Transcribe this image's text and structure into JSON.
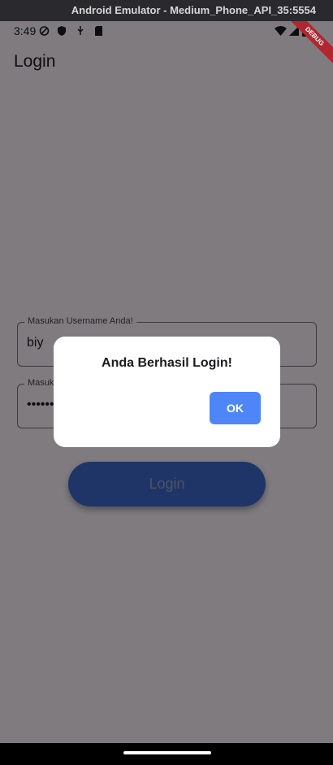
{
  "window": {
    "title": "Android Emulator - Medium_Phone_API_35:5554"
  },
  "status_bar": {
    "time": "3:49"
  },
  "debug_banner": "DEBUG",
  "app_bar": {
    "title": "Login"
  },
  "form": {
    "username": {
      "label": "Masukan Username Anda!",
      "value": "biy"
    },
    "password": {
      "label": "Masukan Password Anda!",
      "value": "••••••"
    },
    "submit_label": "Login"
  },
  "dialog": {
    "message": "Anda Berhasil Login!",
    "ok_label": "OK"
  },
  "colors": {
    "primary": "#3f6bd0",
    "dialog_button": "#4f86f7",
    "debug_banner": "#b3262f"
  }
}
